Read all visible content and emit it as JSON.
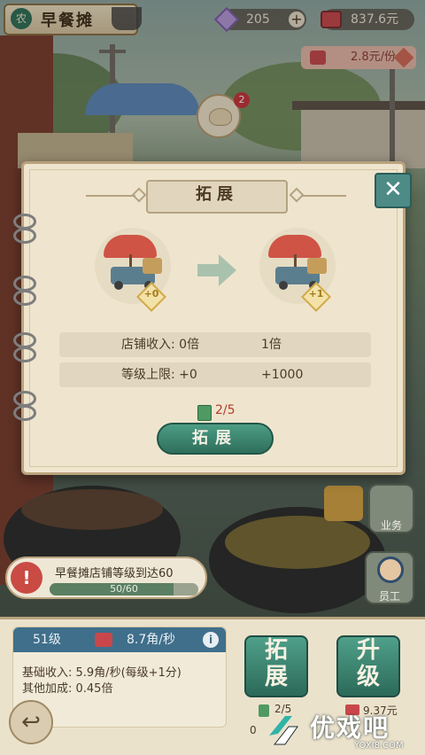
{
  "header": {
    "store_badge": "农",
    "store_name": "早餐摊",
    "gems": "205",
    "gems_plus": "+",
    "money": "837.6元",
    "price": "2.8元/份",
    "notification_count": "2"
  },
  "dialog": {
    "title": "拓展",
    "close_label": "✕",
    "from_level": "+0",
    "to_level": "+1",
    "stats": [
      {
        "label": "店铺收入: 0倍",
        "to": "1倍"
      },
      {
        "label": "等级上限: +0",
        "to": "+1000"
      }
    ],
    "cost": "2/5",
    "button_label": "拓展"
  },
  "side": {
    "business_label": "业务",
    "staff_label": "员工"
  },
  "quest": {
    "alert": "!",
    "text": "早餐摊店铺等级到达60",
    "progress_text": "50/60",
    "progress_fraction": 0.833
  },
  "bottom": {
    "level": "51级",
    "rate": "8.7角/秒",
    "info_icon": "i",
    "base_income": "基础收入: 5.9角/秒(每级+1分)",
    "other_bonus": "其他加成: 0.45倍",
    "expand_line1": "拓",
    "expand_line2": "展",
    "upgrade_line1": "升",
    "upgrade_line2": "级",
    "expand_cost": "2/5",
    "upgrade_cost": "9.37元",
    "zero_label": "0"
  },
  "back_label": "↩",
  "watermark": {
    "text": "优戏吧",
    "url": "YOXI8.COM"
  },
  "colors": {
    "accent_green": "#2f6e5c",
    "alert_red": "#c94b44",
    "level_blue": "#3f6f8b"
  }
}
